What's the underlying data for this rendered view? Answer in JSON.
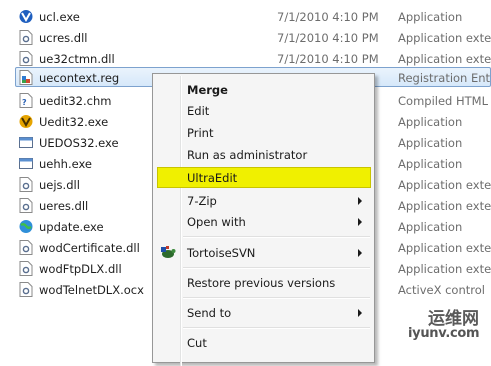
{
  "files": [
    {
      "name": "ucl.exe",
      "date": "7/1/2010 4:10 PM",
      "type": "Application",
      "icon": "ultraedit-app-icon"
    },
    {
      "name": "ucres.dll",
      "date": "7/1/2010 4:10 PM",
      "type": "Application extension",
      "icon": "dll-file-icon"
    },
    {
      "name": "ue32ctmn.dll",
      "date": "7/1/2010 4:10 PM",
      "type": "Application extension",
      "icon": "dll-file-icon"
    },
    {
      "name": "uecontext.reg",
      "date": "",
      "type": "Registration Entries",
      "icon": "reg-file-icon"
    },
    {
      "name": "uedit32.chm",
      "date": "",
      "type": "Compiled HTML Help file",
      "icon": "chm-file-icon"
    },
    {
      "name": "Uedit32.exe",
      "date": "",
      "type": "Application",
      "icon": "ultraedit-app-icon"
    },
    {
      "name": "UEDOS32.exe",
      "date": "",
      "type": "Application",
      "icon": "exe-window-icon"
    },
    {
      "name": "uehh.exe",
      "date": "",
      "type": "Application",
      "icon": "exe-window-icon"
    },
    {
      "name": "uejs.dll",
      "date": "",
      "type": "Application extension",
      "icon": "dll-file-icon"
    },
    {
      "name": "ueres.dll",
      "date": "",
      "type": "Application extension",
      "icon": "dll-file-icon"
    },
    {
      "name": "update.exe",
      "date": "",
      "type": "Application",
      "icon": "update-globe-icon"
    },
    {
      "name": "wodCertificate.dll",
      "date": "",
      "type": "Application extension",
      "icon": "dll-file-icon"
    },
    {
      "name": "wodFtpDLX.dll",
      "date": "",
      "type": "Application extension",
      "icon": "dll-file-icon"
    },
    {
      "name": "wodTelnetDLX.ocx",
      "date": "",
      "type": "ActiveX control",
      "icon": "ocx-file-icon"
    }
  ],
  "context_menu": {
    "merge": "Merge",
    "edit": "Edit",
    "print": "Print",
    "run_as_admin": "Run as administrator",
    "ultraedit": "UltraEdit",
    "seven_zip": "7-Zip",
    "open_with": "Open with",
    "tortoisesvn": "TortoiseSVN",
    "restore_previous_versions": "Restore previous versions",
    "send_to": "Send to",
    "cut": "Cut"
  },
  "watermark": {
    "cn": "运维网",
    "url": "iyunv.com"
  },
  "colors": {
    "highlight": "#f0f000",
    "selection": "#d6e8fa",
    "menu_background": "#f5f5f5"
  }
}
